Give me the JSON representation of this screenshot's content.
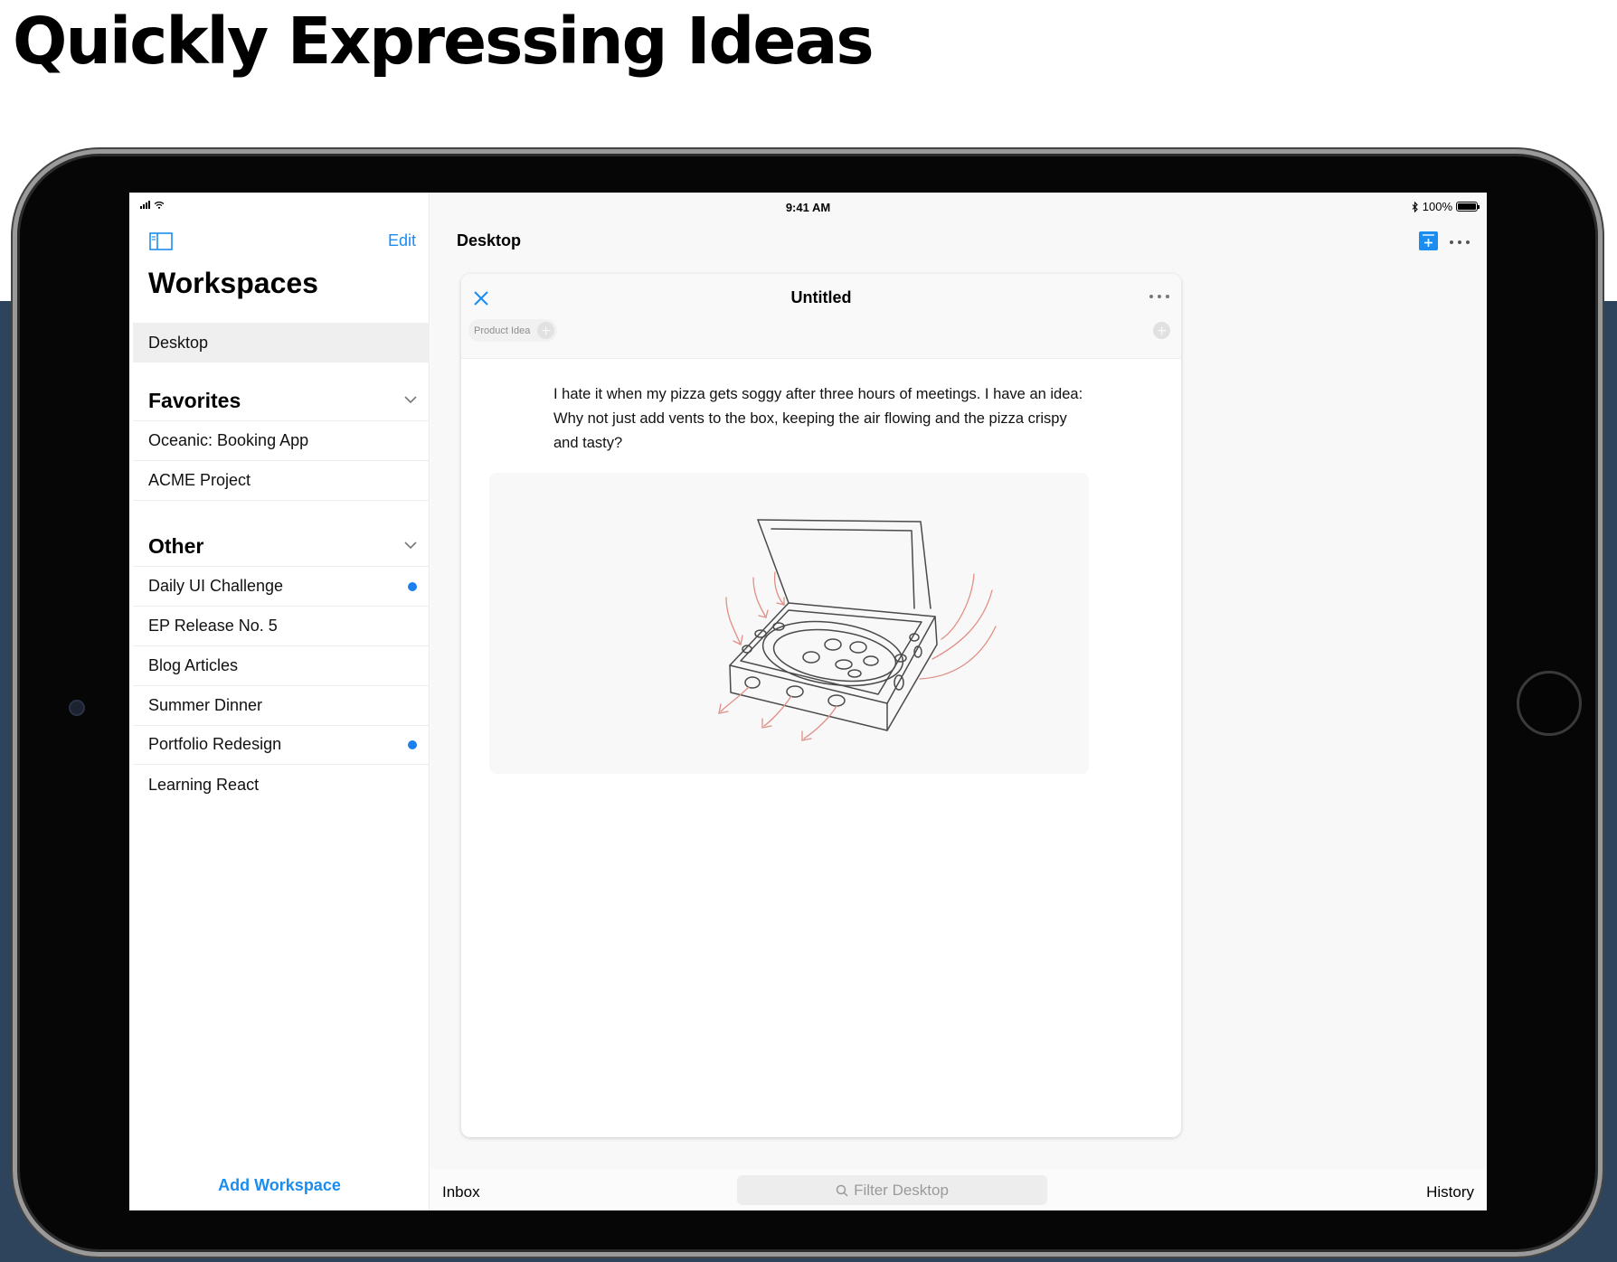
{
  "slide": {
    "title": "Quickly Expressing Ideas"
  },
  "status_bar": {
    "time": "9:41 AM",
    "battery": "100%",
    "battery_level": 1.0
  },
  "sidebar": {
    "edit_label": "Edit",
    "heading": "Workspaces",
    "selected_item": "Desktop",
    "favorites": {
      "label": "Favorites",
      "items": [
        {
          "label": "Oceanic: Booking App",
          "unread": false
        },
        {
          "label": "ACME Project",
          "unread": false
        }
      ]
    },
    "other": {
      "label": "Other",
      "items": [
        {
          "label": "Daily UI Challenge",
          "unread": true
        },
        {
          "label": "EP Release No. 5",
          "unread": false
        },
        {
          "label": "Blog Articles",
          "unread": false
        },
        {
          "label": "Summer Dinner",
          "unread": false
        },
        {
          "label": "Portfolio Redesign",
          "unread": true
        },
        {
          "label": "Learning React",
          "unread": false
        }
      ]
    },
    "add_workspace_label": "Add Workspace"
  },
  "main": {
    "title": "Desktop",
    "note": {
      "title": "Untitled",
      "tag": "Product Idea",
      "text": "I hate it when my pizza gets soggy after three hours of meetings. I have an idea: Why not just add vents to the box, keeping the air flowing and the pizza crispy and tasty?"
    }
  },
  "bottom_bar": {
    "inbox_label": "Inbox",
    "filter_placeholder": "Filter Desktop",
    "history_label": "History"
  },
  "colors": {
    "accent": "#1b8df0",
    "unread_dot": "#1b7ff0",
    "sketch_ink": "#4a4a4a",
    "sketch_arrows": "#e08f86",
    "backdrop": "#2e445d"
  }
}
